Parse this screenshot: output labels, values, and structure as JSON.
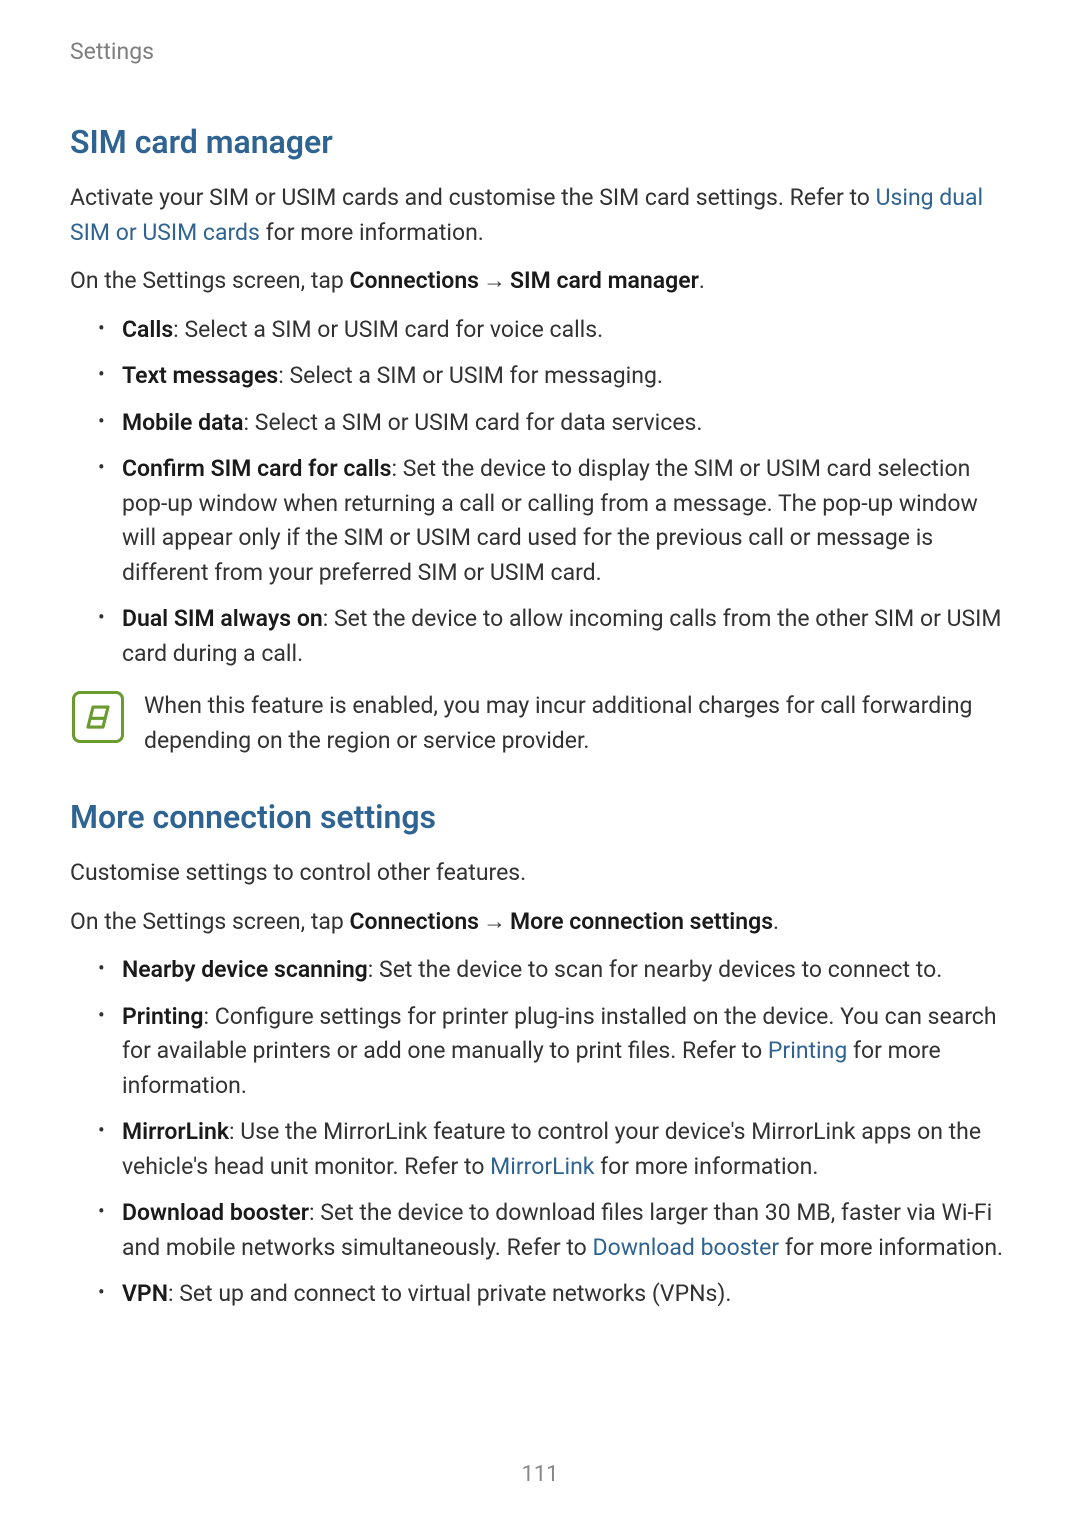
{
  "header": {
    "label": "Settings"
  },
  "section1": {
    "heading": "SIM card manager",
    "intro_prefix": "Activate your SIM or USIM cards and customise the SIM card settings. Refer to ",
    "intro_link": "Using dual SIM or USIM cards",
    "intro_suffix": " for more information.",
    "line2_prefix": "On the Settings screen, tap ",
    "line2_b1": "Connections",
    "arrow": " → ",
    "line2_b2": "SIM card manager",
    "line2_suffix": ".",
    "items": [
      {
        "label": "Calls",
        "text": ": Select a SIM or USIM card for voice calls."
      },
      {
        "label": "Text messages",
        "text": ": Select a SIM or USIM for messaging."
      },
      {
        "label": "Mobile data",
        "text": ": Select a SIM or USIM card for data services."
      },
      {
        "label": "Confirm SIM card for calls",
        "text": ": Set the device to display the SIM or USIM card selection pop-up window when returning a call or calling from a message. The pop-up window will appear only if the SIM or USIM card used for the previous call or message is different from your preferred SIM or USIM card."
      },
      {
        "label": "Dual SIM always on",
        "text": ": Set the device to allow incoming calls from the other SIM or USIM card during a call."
      }
    ],
    "note": "When this feature is enabled, you may incur additional charges for call forwarding depending on the region or service provider."
  },
  "section2": {
    "heading": "More connection settings",
    "intro": "Customise settings to control other features.",
    "line2_prefix": "On the Settings screen, tap ",
    "line2_b1": "Connections",
    "arrow": " → ",
    "line2_b2": "More connection settings",
    "line2_suffix": ".",
    "items": [
      {
        "label": "Nearby device scanning",
        "text": ": Set the device to scan for nearby devices to connect to."
      },
      {
        "label": "Printing",
        "pre": ": Configure settings for printer plug-ins installed on the device. You can search for available printers or add one manually to print files. Refer to ",
        "link": "Printing",
        "post": " for more information."
      },
      {
        "label": "MirrorLink",
        "pre": ": Use the MirrorLink feature to control your device's MirrorLink apps on the vehicle's head unit monitor. Refer to ",
        "link": "MirrorLink",
        "post": " for more information."
      },
      {
        "label": "Download booster",
        "pre": ": Set the device to download files larger than 30 MB, faster via Wi-Fi and mobile networks simultaneously. Refer to ",
        "link": "Download booster",
        "post": " for more information."
      },
      {
        "label": "VPN",
        "text": ": Set up and connect to virtual private networks (VPNs)."
      }
    ]
  },
  "page_number": "111"
}
